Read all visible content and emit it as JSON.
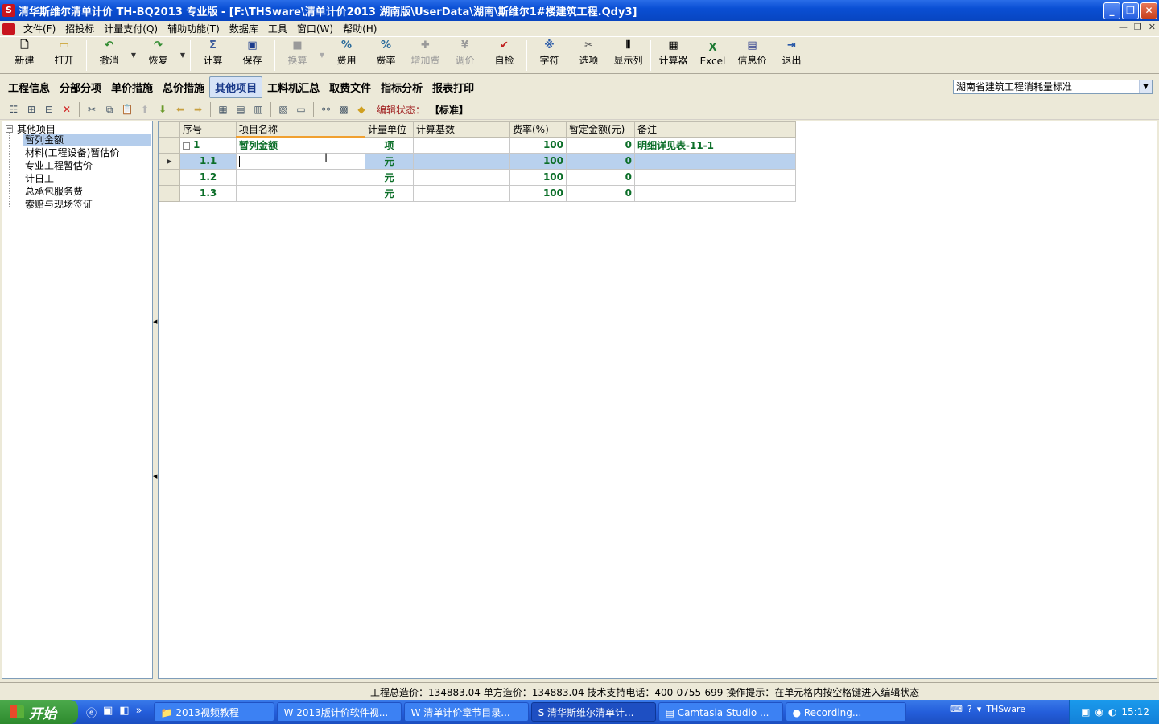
{
  "window": {
    "title": "清华斯维尔清单计价 TH-BQ2013 专业版 - [F:\\THSware\\清单计价2013 湖南版\\UserData\\湖南\\斯维尔1#楼建筑工程.Qdy3]",
    "logo": "S"
  },
  "menu": [
    "文件(F)",
    "招投标",
    "计量支付(Q)",
    "辅助功能(T)",
    "数据库",
    "工具",
    "窗口(W)",
    "帮助(H)"
  ],
  "toolbar": {
    "new": "新建",
    "open": "打开",
    "undo": "撤消",
    "redo": "恢复",
    "calc": "计算",
    "save": "保存",
    "convert": "换算",
    "fee": "费用",
    "rate": "费率",
    "surcharge": "增加费",
    "adjust": "调价",
    "selfcheck": "自检",
    "chars": "字符",
    "options": "选项",
    "columns": "显示列",
    "calculator": "计算器",
    "excel": "Excel",
    "infoprice": "信息价",
    "exit": "退出"
  },
  "tabs": [
    "工程信息",
    "分部分项",
    "单价措施",
    "总价措施",
    "其他项目",
    "工料机汇总",
    "取费文件",
    "指标分析",
    "报表打印"
  ],
  "active_tab": "其他项目",
  "quota_select": "湖南省建筑工程消耗量标准",
  "edit_status": {
    "label": "编辑状态：",
    "value": "【标准】"
  },
  "tree": {
    "root": "其他项目",
    "items": [
      "暂列金额",
      "材料(工程设备)暂估价",
      "专业工程暂估价",
      "计日工",
      "总承包服务费",
      "索赔与现场签证"
    ],
    "selected": "暂列金额"
  },
  "grid": {
    "columns": [
      "序号",
      "项目名称",
      "计量单位",
      "计算基数",
      "费率(%)",
      "暂定金额(元)",
      "备注"
    ],
    "rows": [
      {
        "no": "1",
        "name": "暂列金额",
        "unit": "项",
        "base": "",
        "rate": "100",
        "amount": "0",
        "note": "明细详见表-11-1"
      },
      {
        "no": "1.1",
        "name": "",
        "unit": "元",
        "base": "",
        "rate": "100",
        "amount": "0",
        "note": ""
      },
      {
        "no": "1.2",
        "name": "",
        "unit": "元",
        "base": "",
        "rate": "100",
        "amount": "0",
        "note": ""
      },
      {
        "no": "1.3",
        "name": "",
        "unit": "元",
        "base": "",
        "rate": "100",
        "amount": "0",
        "note": ""
      }
    ]
  },
  "status": "工程总造价：134883.04   单方造价：134883.04   技术支持电话：400-0755-699   操作提示：在单元格内按空格键进入编辑状态",
  "taskbar": {
    "start": "开始",
    "tasks": [
      "2013视频教程",
      "2013版计价软件视...",
      "清单计价章节目录...",
      "清华斯维尔清单计...",
      "Camtasia Studio ...",
      "Recording..."
    ],
    "active_task": "清华斯维尔清单计...",
    "lang": "THSware",
    "clock": "15:12"
  }
}
